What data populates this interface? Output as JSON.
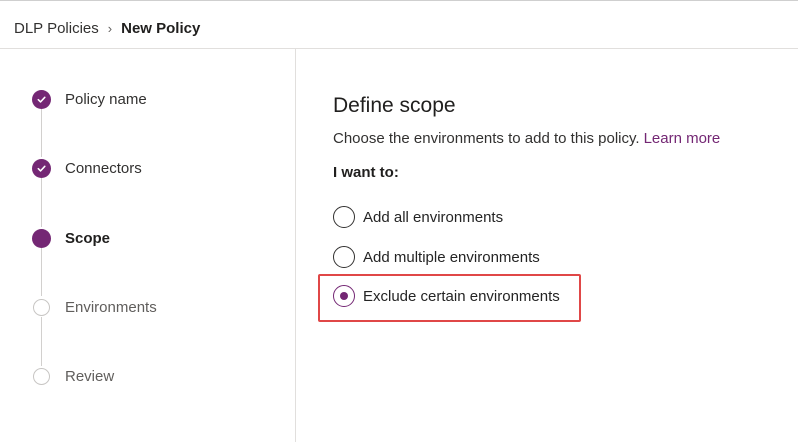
{
  "breadcrumb": {
    "parent": "DLP Policies",
    "separator": "›",
    "current": "New Policy"
  },
  "steps": [
    {
      "label": "Policy name",
      "status": "done"
    },
    {
      "label": "Connectors",
      "status": "done"
    },
    {
      "label": "Scope",
      "status": "current"
    },
    {
      "label": "Environments",
      "status": "todo"
    },
    {
      "label": "Review",
      "status": "todo"
    }
  ],
  "scope": {
    "title": "Define scope",
    "description": "Choose the environments to add to this policy.",
    "learn_more": "Learn more",
    "question": "I want to:",
    "options": [
      {
        "label": "Add all environments",
        "selected": false
      },
      {
        "label": "Add multiple environments",
        "selected": false
      },
      {
        "label": "Exclude certain environments",
        "selected": true
      }
    ]
  },
  "colors": {
    "accent": "#742774",
    "highlight": "#e04747"
  }
}
